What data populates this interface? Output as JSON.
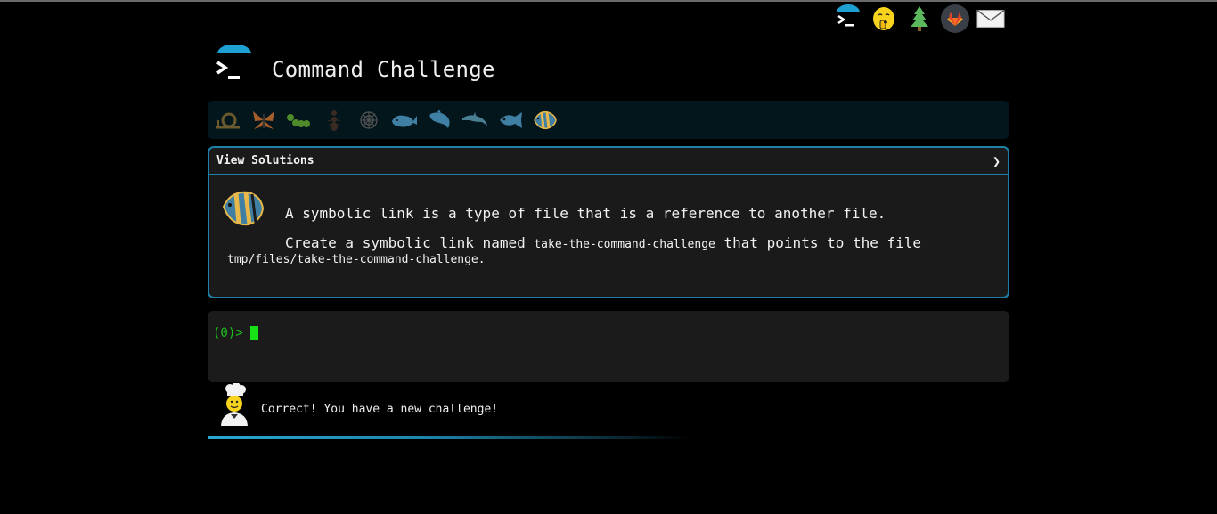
{
  "app": {
    "title": "Command Challenge"
  },
  "top_icons": [
    {
      "name": "terminal-logo-icon"
    },
    {
      "name": "shushing-face-icon"
    },
    {
      "name": "tree-icon"
    },
    {
      "name": "gitlab-icon"
    },
    {
      "name": "mail-icon"
    }
  ],
  "levels": [
    {
      "name": "snail-icon",
      "state": "completed"
    },
    {
      "name": "butterfly-icon",
      "state": "completed"
    },
    {
      "name": "caterpillar-icon",
      "state": "completed"
    },
    {
      "name": "ant-icon",
      "state": "completed"
    },
    {
      "name": "spider-web-icon",
      "state": "completed"
    },
    {
      "name": "whale-icon",
      "state": "completed"
    },
    {
      "name": "shark-icon",
      "state": "completed"
    },
    {
      "name": "dolphin-icon",
      "state": "completed"
    },
    {
      "name": "fish-icon",
      "state": "completed"
    },
    {
      "name": "tropical-fish-icon",
      "state": "current"
    }
  ],
  "challenge": {
    "solutions_label": "View Solutions",
    "chevron": "❯",
    "description_line1": "A symbolic link is a type of file that is a reference to another file.",
    "description_line2_prefix": "Create a symbolic link named ",
    "description_line2_code": "take-the-command-challenge",
    "description_line2_suffix": " that points to the file",
    "description_line3_code": "tmp/files/take-the-command-challenge",
    "description_line3_suffix": "."
  },
  "terminal": {
    "prompt": "(0)>"
  },
  "status": {
    "message": "Correct! You have a new challenge!",
    "progress": 0.6
  },
  "colors": {
    "accent": "#1f7fa6",
    "prompt_green": "#1ec21e",
    "background": "#000000"
  }
}
